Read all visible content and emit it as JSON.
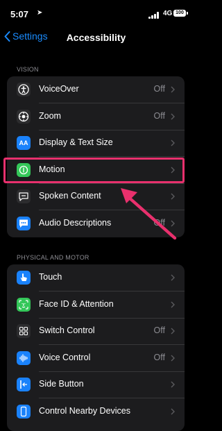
{
  "status_bar": {
    "time": "5:07",
    "network": "4G",
    "battery": "100"
  },
  "nav": {
    "back_label": "Settings",
    "title": "Accessibility"
  },
  "sections": [
    {
      "header": "VISION",
      "rows": [
        {
          "label": "VoiceOver",
          "value": "Off",
          "icon": "voiceover-icon",
          "color": "#2c2c2e"
        },
        {
          "label": "Zoom",
          "value": "Off",
          "icon": "zoom-icon",
          "color": "#2c2c2e"
        },
        {
          "label": "Display & Text Size",
          "value": "",
          "icon": "text-size-icon",
          "color": "#1a82fb",
          "glyph": "AA"
        },
        {
          "label": "Motion",
          "value": "",
          "icon": "motion-icon",
          "color": "#34c759"
        },
        {
          "label": "Spoken Content",
          "value": "",
          "icon": "speech-bubble-icon",
          "color": "#2c2c2e"
        },
        {
          "label": "Audio Descriptions",
          "value": "Off",
          "icon": "audio-description-icon",
          "color": "#1a82fb"
        }
      ]
    },
    {
      "header": "PHYSICAL AND MOTOR",
      "rows": [
        {
          "label": "Touch",
          "value": "",
          "icon": "hand-icon",
          "color": "#1a82fb"
        },
        {
          "label": "Face ID & Attention",
          "value": "",
          "icon": "face-id-icon",
          "color": "#34c759"
        },
        {
          "label": "Switch Control",
          "value": "Off",
          "icon": "switch-control-icon",
          "color": "#2c2c2e"
        },
        {
          "label": "Voice Control",
          "value": "Off",
          "icon": "voice-control-icon",
          "color": "#1a82fb"
        },
        {
          "label": "Side Button",
          "value": "",
          "icon": "side-button-icon",
          "color": "#1a82fb"
        },
        {
          "label": "Control Nearby Devices",
          "value": "",
          "icon": "nearby-devices-icon",
          "color": "#1a82fb"
        }
      ]
    }
  ],
  "colors": {
    "accent": "#1a8cff",
    "highlight": "#e8306d",
    "background": "#000000",
    "group": "#1c1c1e"
  }
}
